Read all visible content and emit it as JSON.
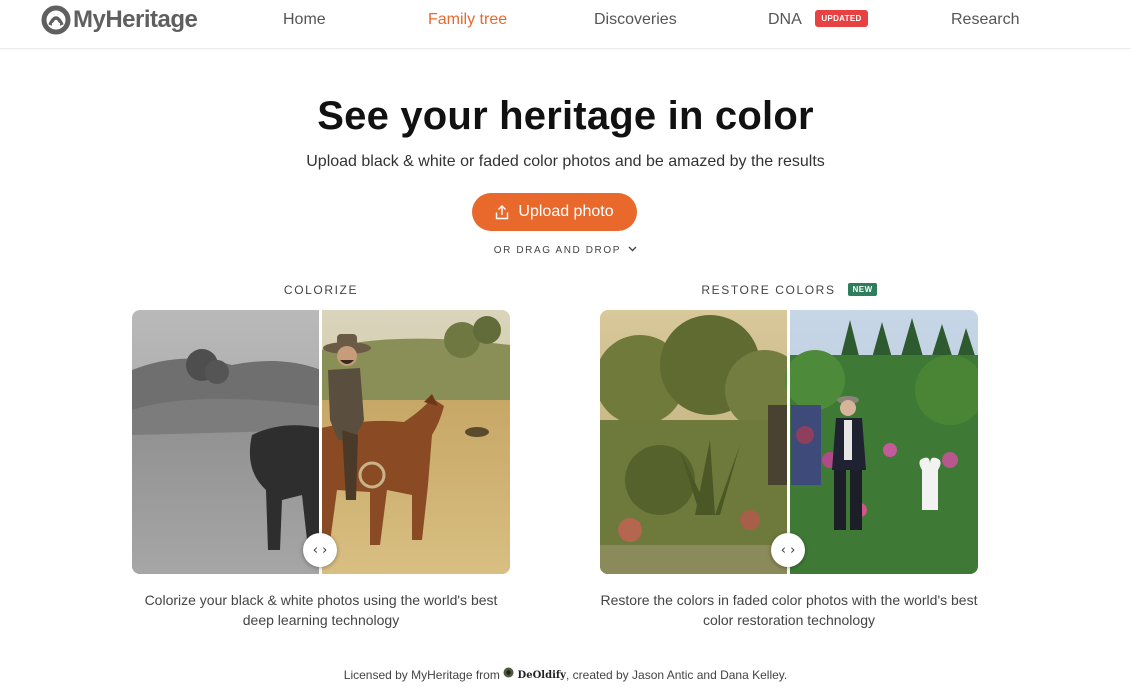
{
  "header": {
    "logo_text": "MyHeritage",
    "nav": [
      {
        "label": "Home"
      },
      {
        "label": "Family tree"
      },
      {
        "label": "Discoveries"
      },
      {
        "label": "DNA",
        "badge": "UPDATED"
      },
      {
        "label": "Research"
      }
    ],
    "active_nav": "Family tree"
  },
  "hero": {
    "title": "See your heritage in color",
    "subtitle": "Upload black & white or faded color photos and be amazed by the results",
    "upload_label": "Upload photo",
    "drag_drop_label": "OR DRAG AND DROP"
  },
  "features": [
    {
      "label": "COLORIZE",
      "caption": "Colorize your black & white photos using the world's best deep learning technology",
      "slider_icon": "‹ ›"
    },
    {
      "label": "RESTORE COLORS",
      "badge": "NEW",
      "caption": "Restore the colors in faded color photos with the world's best color restoration technology",
      "slider_icon": "‹ ›"
    }
  ],
  "footer": {
    "prefix": "Licensed by MyHeritage from",
    "brand": "DeOldify",
    "suffix": ", created by Jason Antic and Dana Kelley."
  },
  "colors": {
    "accent": "#e9692c",
    "badge_updated": "#e84142",
    "badge_new": "#2e7d5b",
    "nav_text": "#555555",
    "title": "#111111"
  },
  "icons": [
    "myheritage-logo-icon",
    "upload-icon",
    "chevron-down-icon",
    "slider-arrows-icon",
    "deoldify-logo-icon"
  ]
}
